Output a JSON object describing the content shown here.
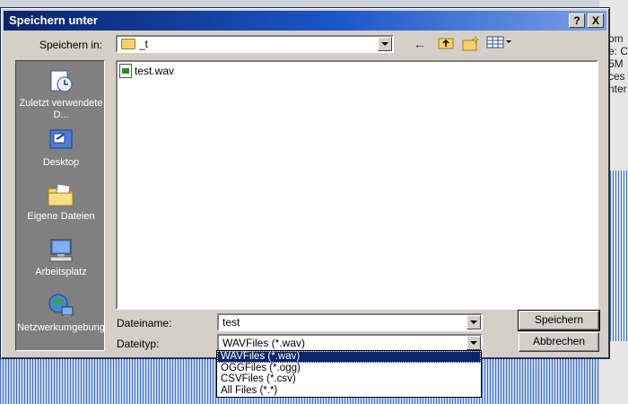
{
  "dialog": {
    "title": "Speichern unter",
    "help_label": "?",
    "close_label": "X"
  },
  "lookin": {
    "label": "Speichern in:",
    "value": "_t"
  },
  "places": [
    {
      "label": "Zuletzt verwendete D..."
    },
    {
      "label": "Desktop"
    },
    {
      "label": "Eigene Dateien"
    },
    {
      "label": "Arbeitsplatz"
    },
    {
      "label": "Netzwerkumgebung"
    }
  ],
  "files": [
    {
      "name": "test.wav"
    }
  ],
  "filename": {
    "label": "Dateiname:",
    "value": "test"
  },
  "filetype": {
    "label": "Dateityp:",
    "value": "WAVFiles (*.wav)",
    "options": [
      "WAVFiles (*.wav)",
      "OGGFiles (*.ogg)",
      "CSVFiles (*.csv)",
      "All Files (*.*)"
    ]
  },
  "buttons": {
    "save": "Speichern",
    "cancel": "Abbrechen"
  },
  "background": {
    "right_texts": [
      "om",
      "e: C",
      "5M",
      "ces",
      "nter"
    ]
  },
  "colors": {
    "title_start": "#0a246a",
    "title_end": "#7aa0e6",
    "selection": "#0a246a"
  }
}
